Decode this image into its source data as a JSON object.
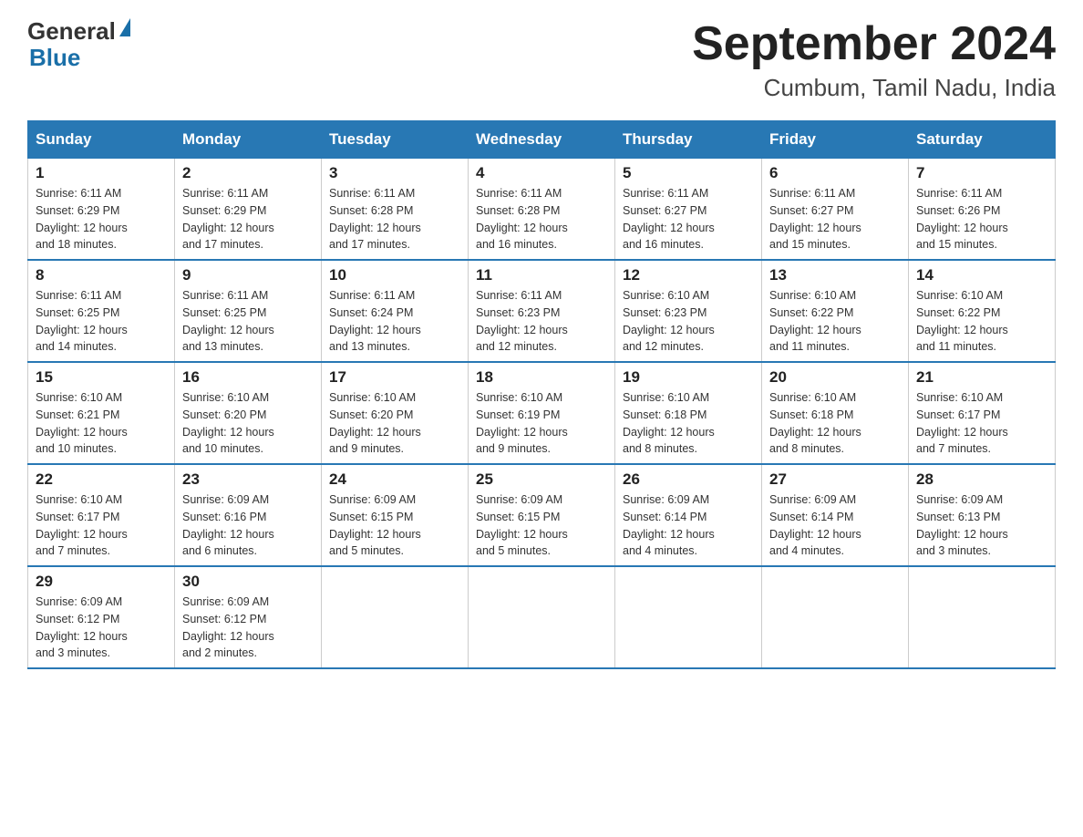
{
  "header": {
    "logo_general": "General",
    "logo_blue": "Blue",
    "month_year": "September 2024",
    "location": "Cumbum, Tamil Nadu, India"
  },
  "days_of_week": [
    "Sunday",
    "Monday",
    "Tuesday",
    "Wednesday",
    "Thursday",
    "Friday",
    "Saturday"
  ],
  "weeks": [
    [
      {
        "day": "1",
        "sunrise": "6:11 AM",
        "sunset": "6:29 PM",
        "daylight": "12 hours and 18 minutes."
      },
      {
        "day": "2",
        "sunrise": "6:11 AM",
        "sunset": "6:29 PM",
        "daylight": "12 hours and 17 minutes."
      },
      {
        "day": "3",
        "sunrise": "6:11 AM",
        "sunset": "6:28 PM",
        "daylight": "12 hours and 17 minutes."
      },
      {
        "day": "4",
        "sunrise": "6:11 AM",
        "sunset": "6:28 PM",
        "daylight": "12 hours and 16 minutes."
      },
      {
        "day": "5",
        "sunrise": "6:11 AM",
        "sunset": "6:27 PM",
        "daylight": "12 hours and 16 minutes."
      },
      {
        "day": "6",
        "sunrise": "6:11 AM",
        "sunset": "6:27 PM",
        "daylight": "12 hours and 15 minutes."
      },
      {
        "day": "7",
        "sunrise": "6:11 AM",
        "sunset": "6:26 PM",
        "daylight": "12 hours and 15 minutes."
      }
    ],
    [
      {
        "day": "8",
        "sunrise": "6:11 AM",
        "sunset": "6:25 PM",
        "daylight": "12 hours and 14 minutes."
      },
      {
        "day": "9",
        "sunrise": "6:11 AM",
        "sunset": "6:25 PM",
        "daylight": "12 hours and 13 minutes."
      },
      {
        "day": "10",
        "sunrise": "6:11 AM",
        "sunset": "6:24 PM",
        "daylight": "12 hours and 13 minutes."
      },
      {
        "day": "11",
        "sunrise": "6:11 AM",
        "sunset": "6:23 PM",
        "daylight": "12 hours and 12 minutes."
      },
      {
        "day": "12",
        "sunrise": "6:10 AM",
        "sunset": "6:23 PM",
        "daylight": "12 hours and 12 minutes."
      },
      {
        "day": "13",
        "sunrise": "6:10 AM",
        "sunset": "6:22 PM",
        "daylight": "12 hours and 11 minutes."
      },
      {
        "day": "14",
        "sunrise": "6:10 AM",
        "sunset": "6:22 PM",
        "daylight": "12 hours and 11 minutes."
      }
    ],
    [
      {
        "day": "15",
        "sunrise": "6:10 AM",
        "sunset": "6:21 PM",
        "daylight": "12 hours and 10 minutes."
      },
      {
        "day": "16",
        "sunrise": "6:10 AM",
        "sunset": "6:20 PM",
        "daylight": "12 hours and 10 minutes."
      },
      {
        "day": "17",
        "sunrise": "6:10 AM",
        "sunset": "6:20 PM",
        "daylight": "12 hours and 9 minutes."
      },
      {
        "day": "18",
        "sunrise": "6:10 AM",
        "sunset": "6:19 PM",
        "daylight": "12 hours and 9 minutes."
      },
      {
        "day": "19",
        "sunrise": "6:10 AM",
        "sunset": "6:18 PM",
        "daylight": "12 hours and 8 minutes."
      },
      {
        "day": "20",
        "sunrise": "6:10 AM",
        "sunset": "6:18 PM",
        "daylight": "12 hours and 8 minutes."
      },
      {
        "day": "21",
        "sunrise": "6:10 AM",
        "sunset": "6:17 PM",
        "daylight": "12 hours and 7 minutes."
      }
    ],
    [
      {
        "day": "22",
        "sunrise": "6:10 AM",
        "sunset": "6:17 PM",
        "daylight": "12 hours and 7 minutes."
      },
      {
        "day": "23",
        "sunrise": "6:09 AM",
        "sunset": "6:16 PM",
        "daylight": "12 hours and 6 minutes."
      },
      {
        "day": "24",
        "sunrise": "6:09 AM",
        "sunset": "6:15 PM",
        "daylight": "12 hours and 5 minutes."
      },
      {
        "day": "25",
        "sunrise": "6:09 AM",
        "sunset": "6:15 PM",
        "daylight": "12 hours and 5 minutes."
      },
      {
        "day": "26",
        "sunrise": "6:09 AM",
        "sunset": "6:14 PM",
        "daylight": "12 hours and 4 minutes."
      },
      {
        "day": "27",
        "sunrise": "6:09 AM",
        "sunset": "6:14 PM",
        "daylight": "12 hours and 4 minutes."
      },
      {
        "day": "28",
        "sunrise": "6:09 AM",
        "sunset": "6:13 PM",
        "daylight": "12 hours and 3 minutes."
      }
    ],
    [
      {
        "day": "29",
        "sunrise": "6:09 AM",
        "sunset": "6:12 PM",
        "daylight": "12 hours and 3 minutes."
      },
      {
        "day": "30",
        "sunrise": "6:09 AM",
        "sunset": "6:12 PM",
        "daylight": "12 hours and 2 minutes."
      },
      null,
      null,
      null,
      null,
      null
    ]
  ],
  "labels": {
    "sunrise": "Sunrise:",
    "sunset": "Sunset:",
    "daylight": "Daylight:"
  }
}
